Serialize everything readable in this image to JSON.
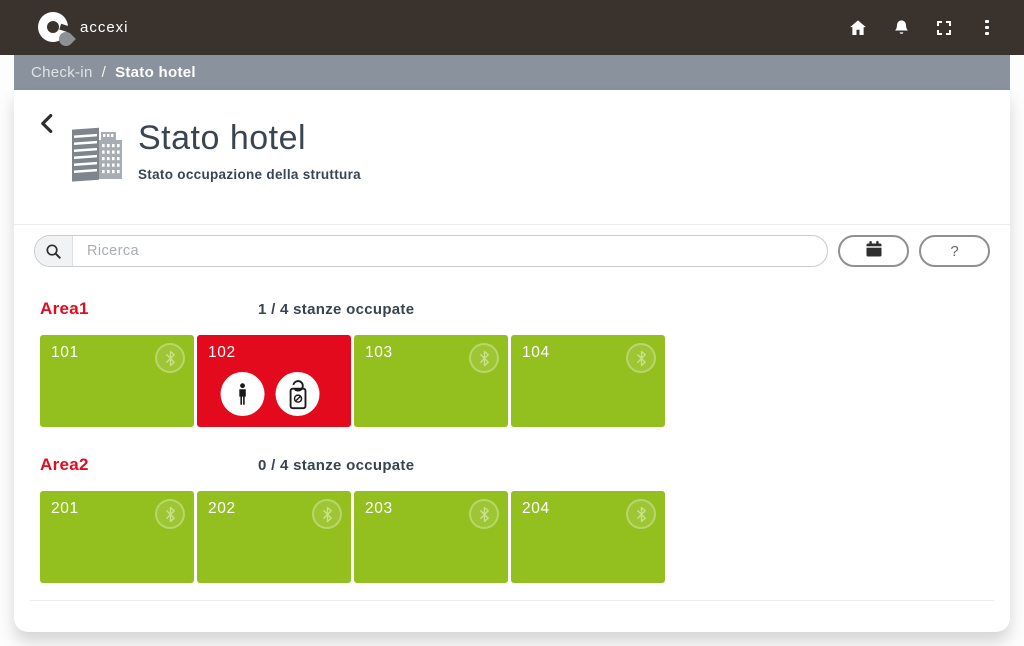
{
  "header": {
    "brand": "accexi",
    "icons": {
      "home": "home-icon",
      "notifications": "bell-icon",
      "fullscreen": "expand-icon",
      "more": "kebab-menu-icon"
    }
  },
  "breadcrumb": {
    "parent": "Check-in",
    "separator": "/",
    "current": "Stato hotel"
  },
  "page": {
    "title": "Stato hotel",
    "subtitle": "Stato occupazione della struttura",
    "back_icon": "chevron-left",
    "title_icon": "hotel-building"
  },
  "toolbar": {
    "search_placeholder": "Ricerca",
    "search_icon": "magnifier",
    "calendar_icon": "calendar",
    "help_label": "?"
  },
  "areas": [
    {
      "name": "Area1",
      "occupancy": "1 / 4 stanze occupate",
      "rooms": [
        {
          "number": "101",
          "status": "free",
          "badge_icon": "bluetooth"
        },
        {
          "number": "102",
          "status": "occupied",
          "status_icons": [
            "person",
            "door-hanger"
          ]
        },
        {
          "number": "103",
          "status": "free",
          "badge_icon": "bluetooth"
        },
        {
          "number": "104",
          "status": "free",
          "badge_icon": "bluetooth"
        }
      ]
    },
    {
      "name": "Area2",
      "occupancy": "0 / 4 stanze occupate",
      "rooms": [
        {
          "number": "201",
          "status": "free",
          "badge_icon": "bluetooth"
        },
        {
          "number": "202",
          "status": "free",
          "badge_icon": "bluetooth"
        },
        {
          "number": "203",
          "status": "free",
          "badge_icon": "bluetooth"
        },
        {
          "number": "204",
          "status": "free",
          "badge_icon": "bluetooth"
        }
      ]
    }
  ],
  "colors": {
    "header_bg": "#3a332d",
    "breadcrumb_bg": "#8a939d",
    "room_free": "#93c01e",
    "room_occupied": "#e30a1e",
    "area_label_red": "#e30b20",
    "text_dark": "#3a4450"
  }
}
